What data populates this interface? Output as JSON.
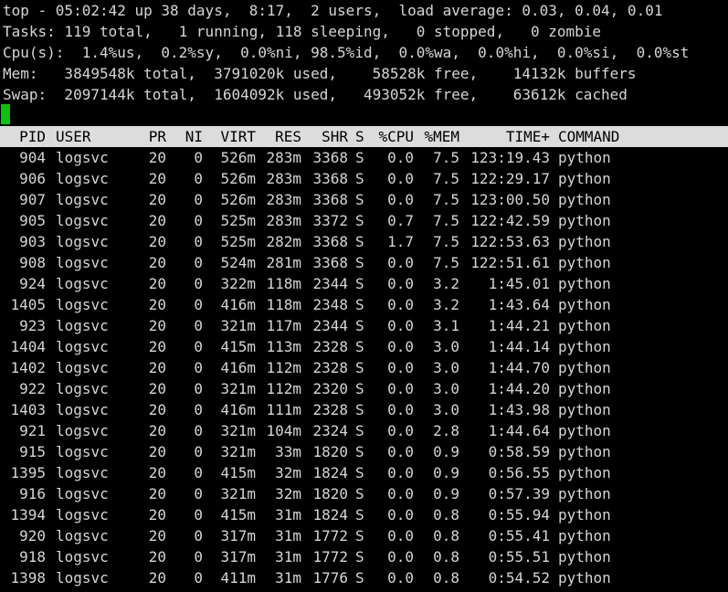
{
  "summary": {
    "top": "top - 05:02:42 up 38 days,  8:17,  2 users,  load average: 0.03, 0.04, 0.01",
    "tasks": "Tasks: 119 total,   1 running, 118 sleeping,   0 stopped,   0 zombie",
    "cpu": "Cpu(s):  1.4%us,  0.2%sy,  0.0%ni, 98.5%id,  0.0%wa,  0.0%hi,  0.0%si,  0.0%st",
    "mem": "Mem:   3849548k total,  3791020k used,    58528k free,    14132k buffers",
    "swap": "Swap:  2097144k total,  1604092k used,   493052k free,    63612k cached"
  },
  "columns": {
    "pid": "PID",
    "user": "USER",
    "pr": "PR",
    "ni": "NI",
    "virt": "VIRT",
    "res": "RES",
    "shr": "SHR",
    "s": "S",
    "cpu": "%CPU",
    "mem": "%MEM",
    "time": "TIME+",
    "command": "COMMAND"
  },
  "processes": [
    {
      "pid": "904",
      "user": "logsvc",
      "pr": "20",
      "ni": "0",
      "virt": "526m",
      "res": "283m",
      "shr": "3368",
      "s": "S",
      "cpu": "0.0",
      "mem": "7.5",
      "time": "123:19.43",
      "command": "python"
    },
    {
      "pid": "906",
      "user": "logsvc",
      "pr": "20",
      "ni": "0",
      "virt": "526m",
      "res": "283m",
      "shr": "3368",
      "s": "S",
      "cpu": "0.0",
      "mem": "7.5",
      "time": "122:29.17",
      "command": "python"
    },
    {
      "pid": "907",
      "user": "logsvc",
      "pr": "20",
      "ni": "0",
      "virt": "526m",
      "res": "283m",
      "shr": "3368",
      "s": "S",
      "cpu": "0.0",
      "mem": "7.5",
      "time": "123:00.50",
      "command": "python"
    },
    {
      "pid": "905",
      "user": "logsvc",
      "pr": "20",
      "ni": "0",
      "virt": "525m",
      "res": "283m",
      "shr": "3372",
      "s": "S",
      "cpu": "0.7",
      "mem": "7.5",
      "time": "122:42.59",
      "command": "python"
    },
    {
      "pid": "903",
      "user": "logsvc",
      "pr": "20",
      "ni": "0",
      "virt": "525m",
      "res": "282m",
      "shr": "3368",
      "s": "S",
      "cpu": "1.7",
      "mem": "7.5",
      "time": "122:53.63",
      "command": "python"
    },
    {
      "pid": "908",
      "user": "logsvc",
      "pr": "20",
      "ni": "0",
      "virt": "524m",
      "res": "281m",
      "shr": "3368",
      "s": "S",
      "cpu": "0.0",
      "mem": "7.5",
      "time": "122:51.61",
      "command": "python"
    },
    {
      "pid": "924",
      "user": "logsvc",
      "pr": "20",
      "ni": "0",
      "virt": "322m",
      "res": "118m",
      "shr": "2344",
      "s": "S",
      "cpu": "0.0",
      "mem": "3.2",
      "time": "1:45.01",
      "command": "python"
    },
    {
      "pid": "1405",
      "user": "logsvc",
      "pr": "20",
      "ni": "0",
      "virt": "416m",
      "res": "118m",
      "shr": "2348",
      "s": "S",
      "cpu": "0.0",
      "mem": "3.2",
      "time": "1:43.64",
      "command": "python"
    },
    {
      "pid": "923",
      "user": "logsvc",
      "pr": "20",
      "ni": "0",
      "virt": "321m",
      "res": "117m",
      "shr": "2344",
      "s": "S",
      "cpu": "0.0",
      "mem": "3.1",
      "time": "1:44.21",
      "command": "python"
    },
    {
      "pid": "1404",
      "user": "logsvc",
      "pr": "20",
      "ni": "0",
      "virt": "415m",
      "res": "113m",
      "shr": "2328",
      "s": "S",
      "cpu": "0.0",
      "mem": "3.0",
      "time": "1:44.14",
      "command": "python"
    },
    {
      "pid": "1402",
      "user": "logsvc",
      "pr": "20",
      "ni": "0",
      "virt": "416m",
      "res": "112m",
      "shr": "2328",
      "s": "S",
      "cpu": "0.0",
      "mem": "3.0",
      "time": "1:44.70",
      "command": "python"
    },
    {
      "pid": "922",
      "user": "logsvc",
      "pr": "20",
      "ni": "0",
      "virt": "321m",
      "res": "112m",
      "shr": "2320",
      "s": "S",
      "cpu": "0.0",
      "mem": "3.0",
      "time": "1:44.20",
      "command": "python"
    },
    {
      "pid": "1403",
      "user": "logsvc",
      "pr": "20",
      "ni": "0",
      "virt": "416m",
      "res": "111m",
      "shr": "2328",
      "s": "S",
      "cpu": "0.0",
      "mem": "3.0",
      "time": "1:43.98",
      "command": "python"
    },
    {
      "pid": "921",
      "user": "logsvc",
      "pr": "20",
      "ni": "0",
      "virt": "321m",
      "res": "104m",
      "shr": "2324",
      "s": "S",
      "cpu": "0.0",
      "mem": "2.8",
      "time": "1:44.64",
      "command": "python"
    },
    {
      "pid": "915",
      "user": "logsvc",
      "pr": "20",
      "ni": "0",
      "virt": "321m",
      "res": "33m",
      "shr": "1820",
      "s": "S",
      "cpu": "0.0",
      "mem": "0.9",
      "time": "0:58.59",
      "command": "python"
    },
    {
      "pid": "1395",
      "user": "logsvc",
      "pr": "20",
      "ni": "0",
      "virt": "415m",
      "res": "32m",
      "shr": "1824",
      "s": "S",
      "cpu": "0.0",
      "mem": "0.9",
      "time": "0:56.55",
      "command": "python"
    },
    {
      "pid": "916",
      "user": "logsvc",
      "pr": "20",
      "ni": "0",
      "virt": "321m",
      "res": "32m",
      "shr": "1820",
      "s": "S",
      "cpu": "0.0",
      "mem": "0.9",
      "time": "0:57.39",
      "command": "python"
    },
    {
      "pid": "1394",
      "user": "logsvc",
      "pr": "20",
      "ni": "0",
      "virt": "415m",
      "res": "31m",
      "shr": "1824",
      "s": "S",
      "cpu": "0.0",
      "mem": "0.8",
      "time": "0:55.94",
      "command": "python"
    },
    {
      "pid": "920",
      "user": "logsvc",
      "pr": "20",
      "ni": "0",
      "virt": "317m",
      "res": "31m",
      "shr": "1772",
      "s": "S",
      "cpu": "0.0",
      "mem": "0.8",
      "time": "0:55.41",
      "command": "python"
    },
    {
      "pid": "918",
      "user": "logsvc",
      "pr": "20",
      "ni": "0",
      "virt": "317m",
      "res": "31m",
      "shr": "1772",
      "s": "S",
      "cpu": "0.0",
      "mem": "0.8",
      "time": "0:55.51",
      "command": "python"
    },
    {
      "pid": "1398",
      "user": "logsvc",
      "pr": "20",
      "ni": "0",
      "virt": "411m",
      "res": "31m",
      "shr": "1776",
      "s": "S",
      "cpu": "0.0",
      "mem": "0.8",
      "time": "0:54.52",
      "command": "python"
    }
  ],
  "colors": {
    "background": "#000000",
    "text": "#d6d6d6",
    "header_bg": "#dcdcdc",
    "cursor": "#10c010"
  }
}
